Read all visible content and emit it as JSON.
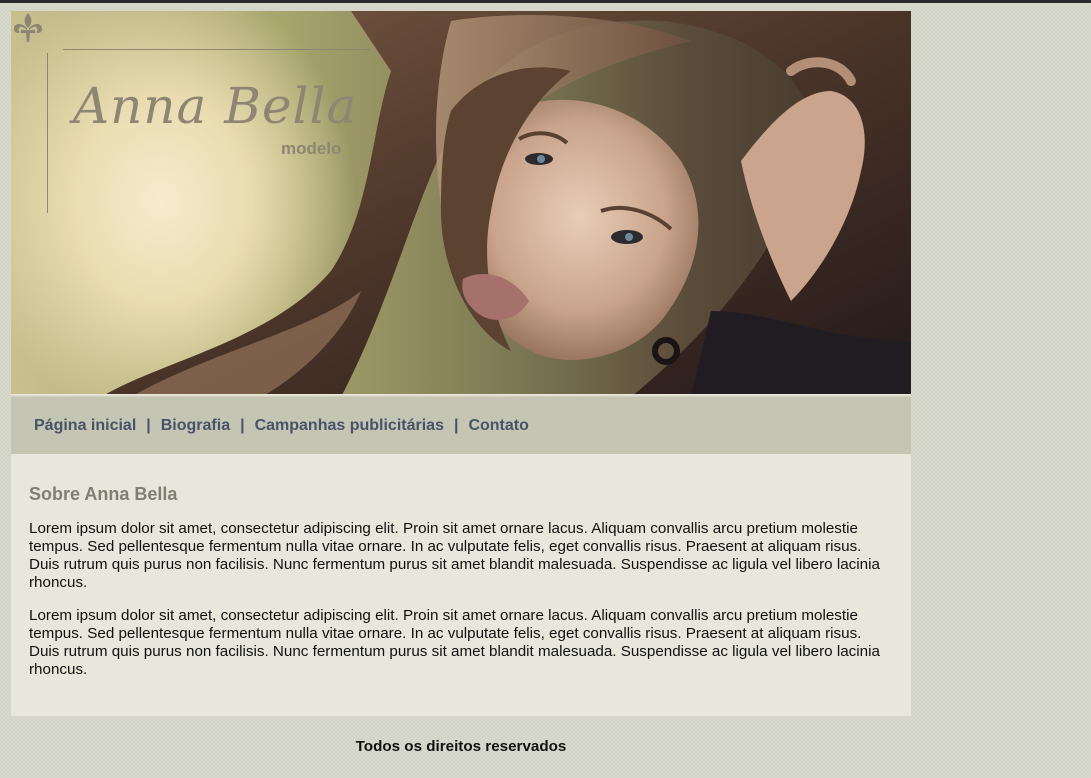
{
  "header": {
    "brand_name": "Anna Bella",
    "brand_subtitle": "modelo"
  },
  "nav": {
    "items": [
      {
        "label": "Página inicial"
      },
      {
        "label": "Biografia"
      },
      {
        "label": "Campanhas publicitárias"
      },
      {
        "label": "Contato"
      }
    ],
    "separator": "|"
  },
  "main": {
    "heading": "Sobre Anna Bella",
    "paragraphs": [
      "Lorem ipsum dolor sit amet, consectetur adipiscing elit. Proin sit amet ornare lacus. Aliquam convallis arcu pretium molestie tempus. Sed pellentesque fermentum nulla vitae ornare. In ac vulputate felis, eget convallis risus. Praesent at aliquam risus. Duis rutrum quis purus non facilisis. Nunc fermentum purus sit amet blandit malesuada. Suspendisse ac ligula vel libero lacinia rhoncus.",
      "Lorem ipsum dolor sit amet, consectetur adipiscing elit. Proin sit amet ornare lacus. Aliquam convallis arcu pretium molestie tempus. Sed pellentesque fermentum nulla vitae ornare. In ac vulputate felis, eget convallis risus. Praesent at aliquam risus. Duis rutrum quis purus non facilisis. Nunc fermentum purus sit amet blandit malesuada. Suspendisse ac ligula vel libero lacinia rhoncus."
    ]
  },
  "footer": {
    "text": "Todos os direitos reservados"
  },
  "colors": {
    "page_background": "#d8d9cd",
    "nav_background": "#c5c5b3",
    "nav_link": "#48536a",
    "content_background": "#e7e7db",
    "heading": "#7f7f72",
    "brand": "#8d8672"
  },
  "icons": {
    "logo_ornament": "fleur-de-lis-icon"
  }
}
